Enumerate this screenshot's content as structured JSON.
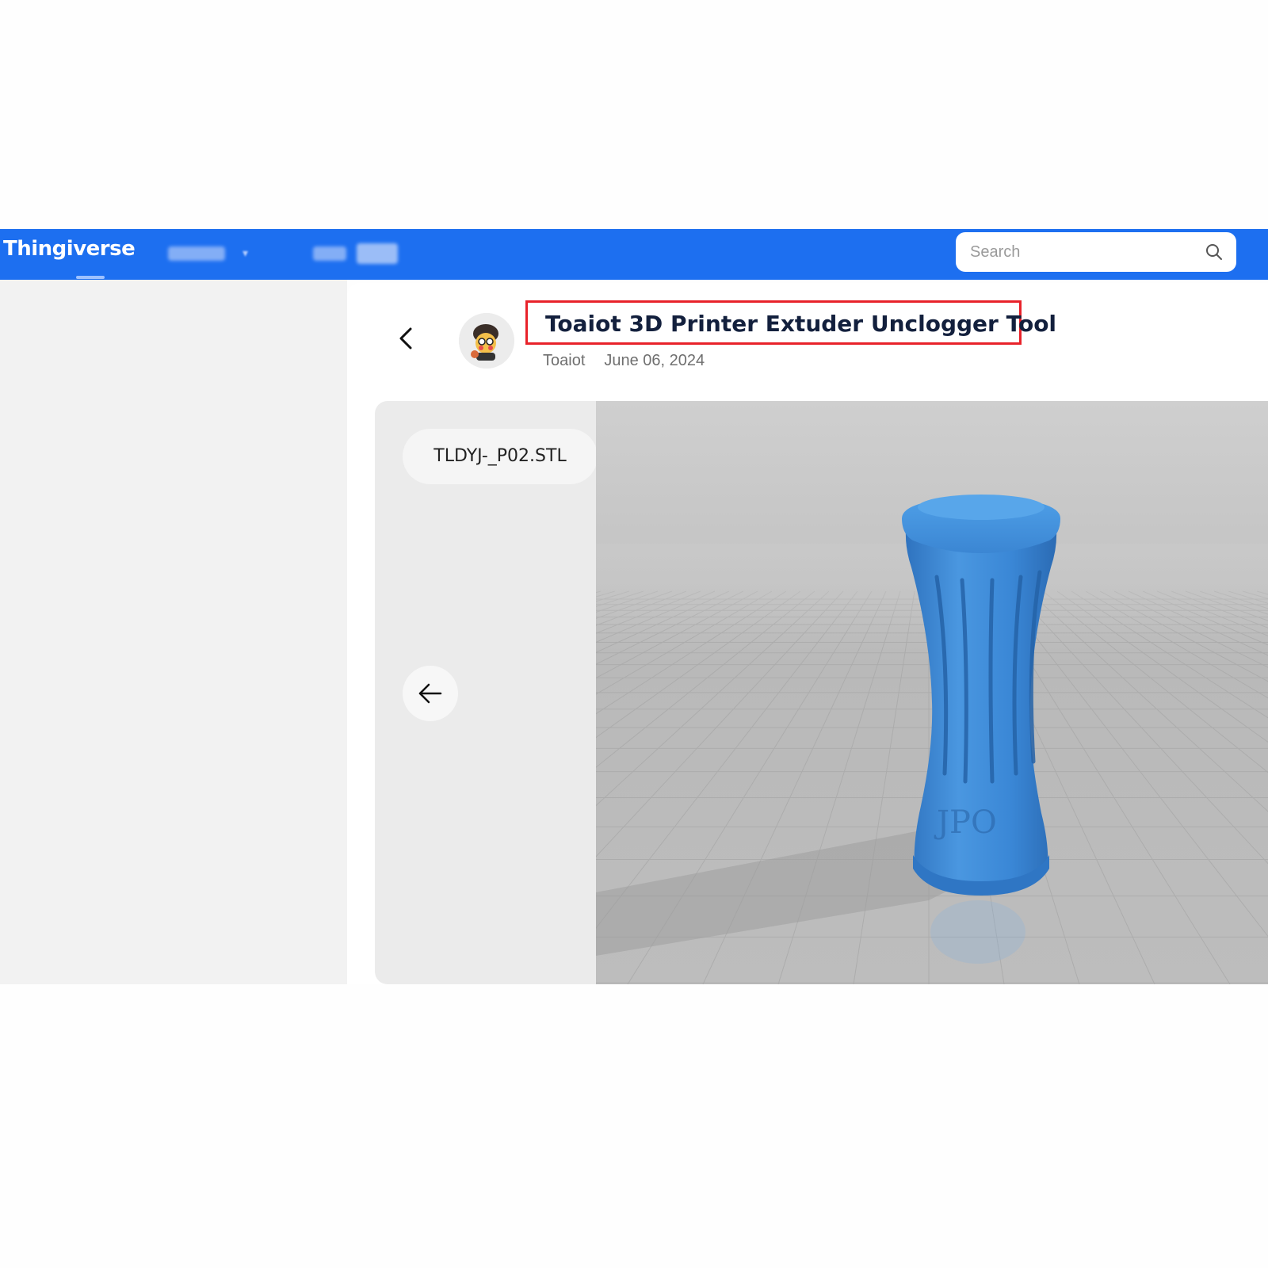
{
  "header": {
    "logo": "Thingiverse",
    "search_placeholder": "Search"
  },
  "thing": {
    "title": "Toaiot 3D Printer Extuder Unclogger Tool",
    "author": "Toaiot",
    "date": "June 06, 2024"
  },
  "viewer": {
    "file_name": "TLDYJ-_P02.STL"
  },
  "colors": {
    "brand_blue": "#1d6ff0",
    "highlight_red": "#e8222a",
    "model_blue": "#3a87d6"
  }
}
